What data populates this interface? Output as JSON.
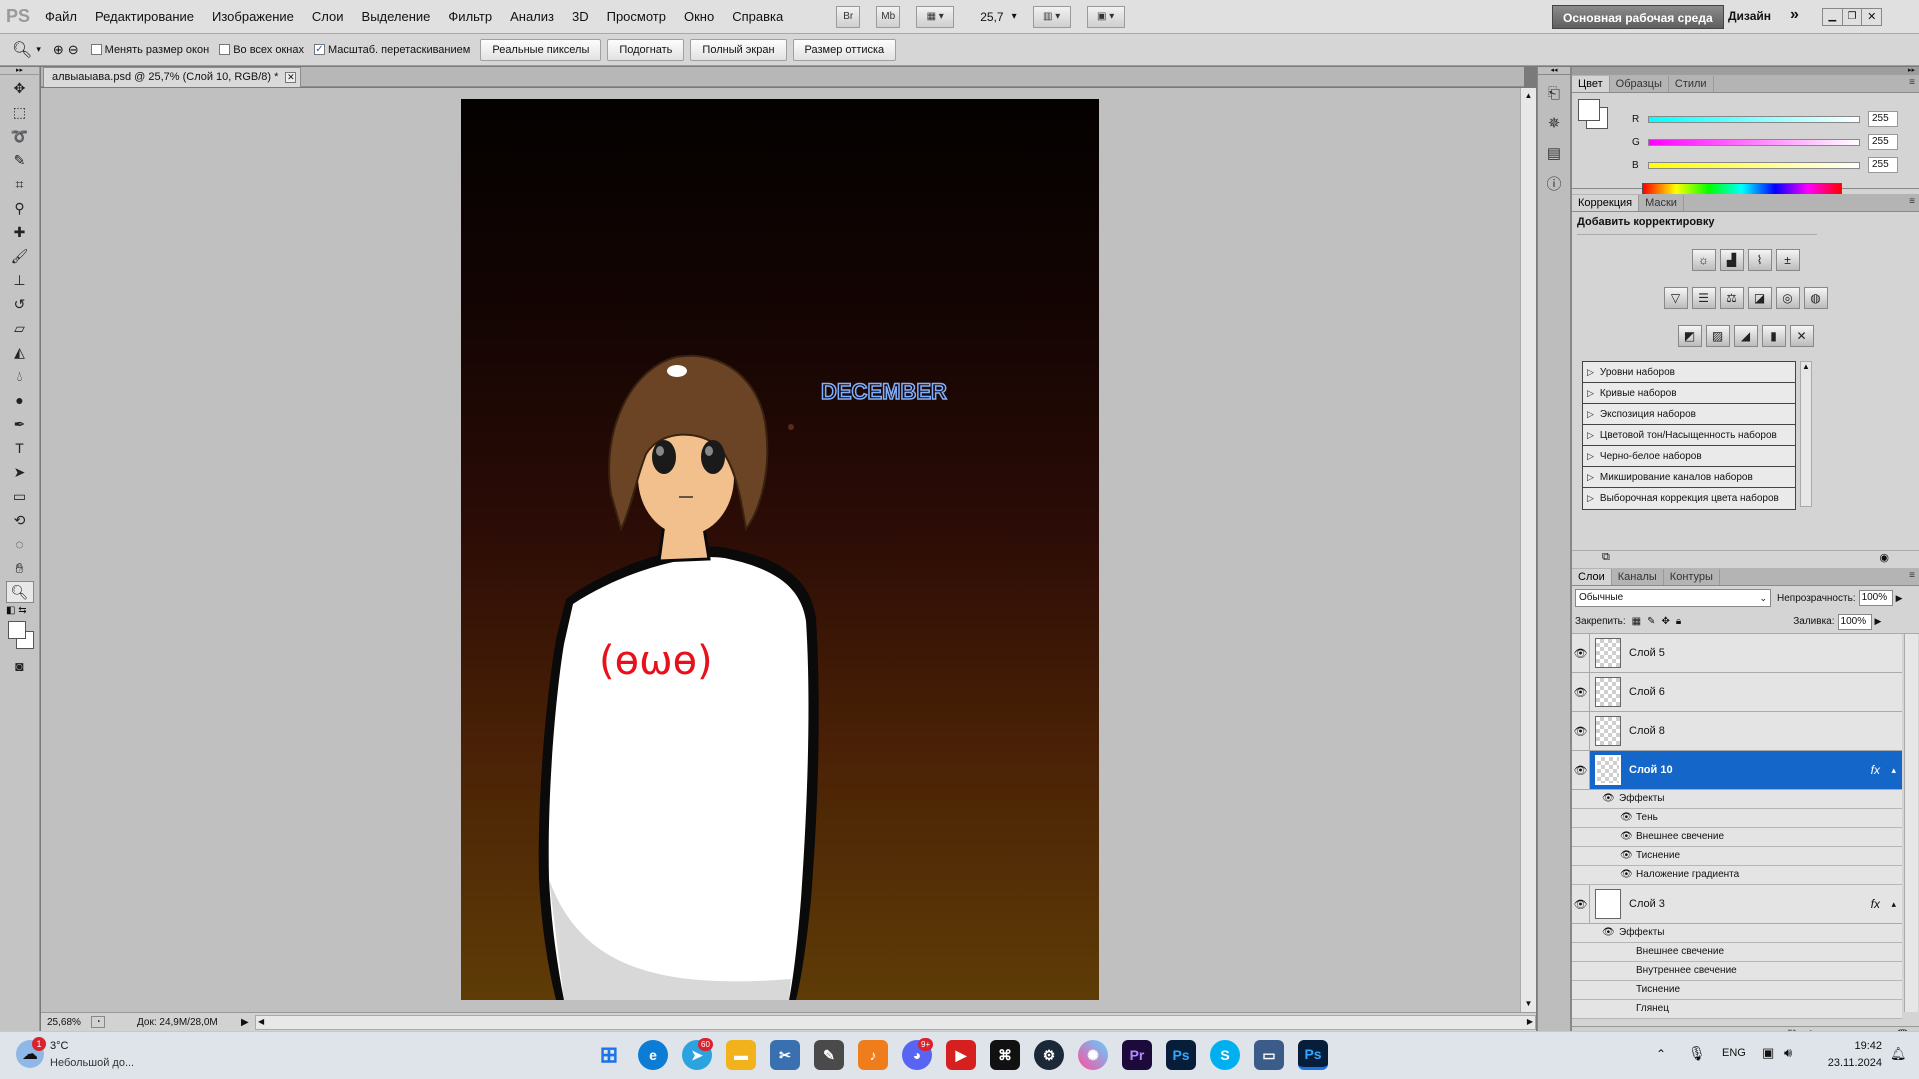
{
  "app": {
    "logo": "PS",
    "menu": [
      "Файл",
      "Редактирование",
      "Изображение",
      "Слои",
      "Выделение",
      "Фильтр",
      "Анализ",
      "3D",
      "Просмотр",
      "Окно",
      "Справка"
    ],
    "bridge_btn": "Br",
    "minibridge_btn": "Mb",
    "zoom_value": "25,7",
    "workspace_button": "Основная рабочая среда",
    "workspace_design": "Дизайн",
    "more_label": "»"
  },
  "options": {
    "checkbox_resize": "Менять размер окон",
    "checkbox_all_windows": "Во всех окнах",
    "checkbox_scrubby": "Масштаб. перетаскиванием",
    "btn_actual": "Реальные пикселы",
    "btn_fit": "Подогнать",
    "btn_full": "Полный экран",
    "btn_print": "Размер оттиска"
  },
  "document": {
    "tab_title": "алвыаыава.psd @ 25,7% (Слой 10, RGB/8) *",
    "zoom_status": "25,68%",
    "doc_size": "Док: 24,9M/28,0M"
  },
  "art": {
    "text_logo": "DECEMBER",
    "shirt_text": "(ɵωɵ)"
  },
  "color_panel": {
    "tabs": [
      "Цвет",
      "Образцы",
      "Стили"
    ],
    "r_label": "R",
    "g_label": "G",
    "b_label": "B",
    "r": "255",
    "g": "255",
    "b": "255"
  },
  "adjust_panel": {
    "tabs": [
      "Коррекция",
      "Маски"
    ],
    "title": "Добавить корректировку",
    "presets": [
      "Уровни наборов",
      "Кривые наборов",
      "Экспозиция наборов",
      "Цветовой тон/Насыщенность наборов",
      "Черно-белое наборов",
      "Микширование каналов наборов",
      "Выборочная коррекция цвета наборов"
    ]
  },
  "layers_panel": {
    "tabs": [
      "Слои",
      "Каналы",
      "Контуры"
    ],
    "blend_mode": "Обычные",
    "opacity_label": "Непрозрачность:",
    "opacity": "100%",
    "lock_label": "Закрепить:",
    "fill_label": "Заливка:",
    "fill": "100%",
    "fx_label": "fx",
    "effects_label": "Эффекты",
    "layers": [
      {
        "name": "Слой 5"
      },
      {
        "name": "Слой 6"
      },
      {
        "name": "Слой 8"
      },
      {
        "name": "Слой 10"
      }
    ],
    "layer10_effects": [
      "Тень",
      "Внешнее свечение",
      "Тиснение",
      "Наложение градиента"
    ],
    "layer3_name": "Слой 3",
    "layer3_effects": [
      "Внешнее свечение",
      "Внутреннее свечение",
      "Тиснение",
      "Глянец"
    ]
  },
  "taskbar": {
    "weather_temp": "3°C",
    "weather_desc": "Небольшой до...",
    "weather_badge": "1",
    "telegram_badge": "60",
    "discord_badge": "9+",
    "lang": "ENG",
    "time": "19:42",
    "date": "23.11.2024"
  }
}
